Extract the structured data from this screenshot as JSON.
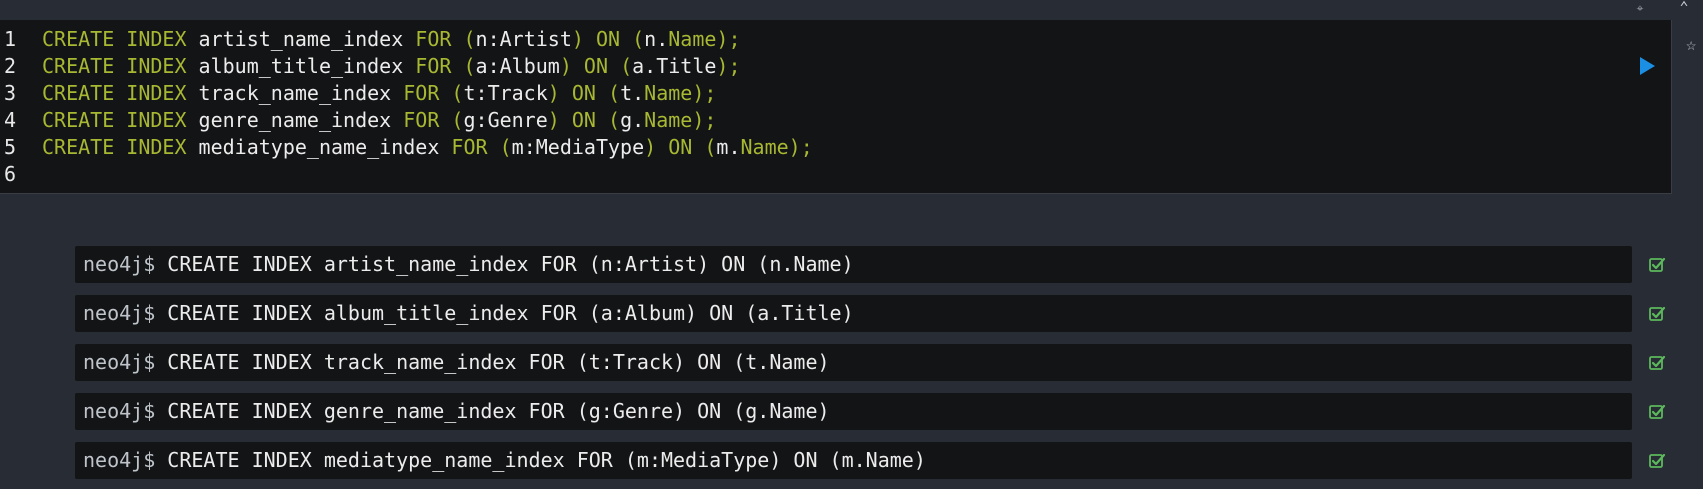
{
  "editor": {
    "lines": [
      {
        "num": "1",
        "kw": "CREATE INDEX",
        "name": "artist_name_index",
        "for": "FOR",
        "open": "(",
        "var": "n",
        "colon": ":",
        "label": "Artist",
        "close": ")",
        "on": "ON",
        "open2": "(",
        "var2": "n",
        "dot": ".",
        "prop": "Name",
        "end": ");"
      },
      {
        "num": "2",
        "kw": "CREATE INDEX",
        "name": "album_title_index",
        "for": "FOR",
        "open": "(",
        "var": "a",
        "colon": ":",
        "label": "Album",
        "close": ")",
        "on": "ON",
        "open2": "(",
        "var2": "a",
        "dot": ".",
        "prop": "Title",
        "end": ");"
      },
      {
        "num": "3",
        "kw": "CREATE INDEX",
        "name": "track_name_index",
        "for": "FOR",
        "open": "(",
        "var": "t",
        "colon": ":",
        "label": "Track",
        "close": ")",
        "on": "ON",
        "open2": "(",
        "var2": "t",
        "dot": ".",
        "prop": "Name",
        "end": ");"
      },
      {
        "num": "4",
        "kw": "CREATE INDEX",
        "name": "genre_name_index",
        "for": "FOR",
        "open": "(",
        "var": "g",
        "colon": ":",
        "label": "Genre",
        "close": ")",
        "on": "ON",
        "open2": "(",
        "var2": "g",
        "dot": ".",
        "prop": "Name",
        "end": ");"
      },
      {
        "num": "5",
        "kw": "CREATE INDEX",
        "name": "mediatype_name_index",
        "for": "FOR",
        "open": "(",
        "var": "m",
        "colon": ":",
        "label": "MediaType",
        "close": ")",
        "on": "ON",
        "open2": "(",
        "var2": "m",
        "dot": ".",
        "prop": "Name",
        "end": ");"
      }
    ],
    "last_line_num": "6"
  },
  "results": [
    {
      "prompt": "neo4j$",
      "query": "CREATE INDEX artist_name_index FOR (n:Artist) ON (n.Name)",
      "status": "success"
    },
    {
      "prompt": "neo4j$",
      "query": "CREATE INDEX album_title_index FOR (a:Album) ON (a.Title)",
      "status": "success"
    },
    {
      "prompt": "neo4j$",
      "query": "CREATE INDEX track_name_index FOR (t:Track) ON (t.Name)",
      "status": "success"
    },
    {
      "prompt": "neo4j$",
      "query": "CREATE INDEX genre_name_index FOR (g:Genre) ON (g.Name)",
      "status": "success"
    },
    {
      "prompt": "neo4j$",
      "query": "CREATE INDEX mediatype_name_index FOR (m:MediaType) ON (m.Name)",
      "status": "success"
    }
  ],
  "icons": {
    "pin": "pin-icon",
    "collapse": "chevron-up-icon",
    "run": "play-icon",
    "favorite": "star-icon",
    "success": "check-square-icon"
  },
  "colors": {
    "keyword": "#a8b832",
    "run": "#1a8fe3",
    "success": "#5cb85c",
    "editor_bg": "#131416",
    "page_bg": "#282c34"
  }
}
